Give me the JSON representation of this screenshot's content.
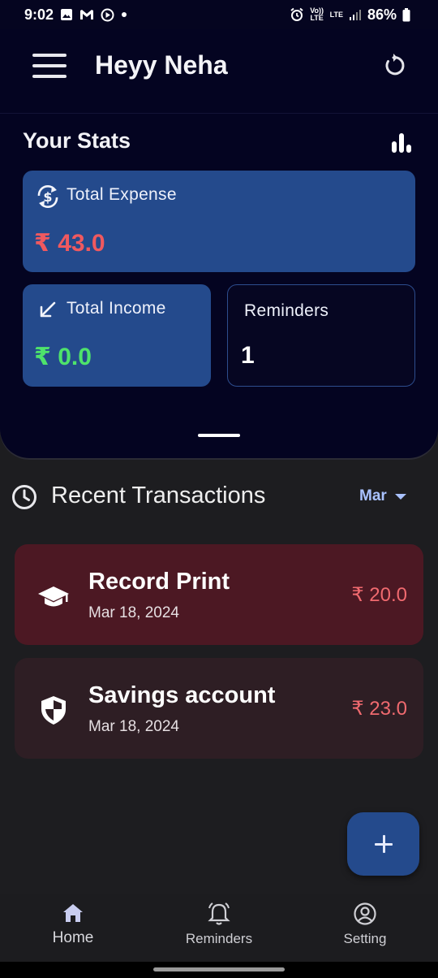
{
  "status_bar": {
    "time": "9:02",
    "battery": "86%",
    "volte_label": "Vo)) LTE",
    "lte_label": "LTE"
  },
  "header": {
    "title": "Heyy Neha",
    "menu_icon": "hamburger-menu-icon",
    "refresh_icon": "refresh-icon"
  },
  "stats": {
    "title": "Your Stats",
    "icon": "bar-chart-icon",
    "total_expense": {
      "label": "Total Expense",
      "value": "₹ 43.0",
      "icon": "currency-exchange-icon"
    },
    "total_income": {
      "label": "Total Income",
      "value": "₹ 0.0",
      "icon": "arrow-down-left-icon"
    },
    "reminders": {
      "label": "Reminders",
      "value": "1"
    }
  },
  "recent": {
    "title": "Recent Transactions",
    "month": "Mar",
    "transactions": [
      {
        "name": "Record Print",
        "date": "Mar 18, 2024",
        "amount": "₹ 20.0",
        "icon": "graduation-cap-icon"
      },
      {
        "name": "Savings account",
        "date": "Mar 18, 2024",
        "amount": "₹ 23.0",
        "icon": "shield-icon"
      }
    ]
  },
  "fab": {
    "icon": "plus-icon"
  },
  "bottom_nav": [
    {
      "label": "Home",
      "icon": "home-icon"
    },
    {
      "label": "Reminders",
      "icon": "bell-icon"
    },
    {
      "label": "Setting",
      "icon": "account-circle-icon"
    }
  ],
  "colors": {
    "panel_bg": "#040421",
    "card_blue": "#244a8c",
    "expense_red": "#f0595f",
    "income_green": "#4ee36b",
    "txn1_bg": "#4c1823",
    "txn2_bg": "#2e1e24",
    "accent_light_blue": "#a9c2ff"
  }
}
